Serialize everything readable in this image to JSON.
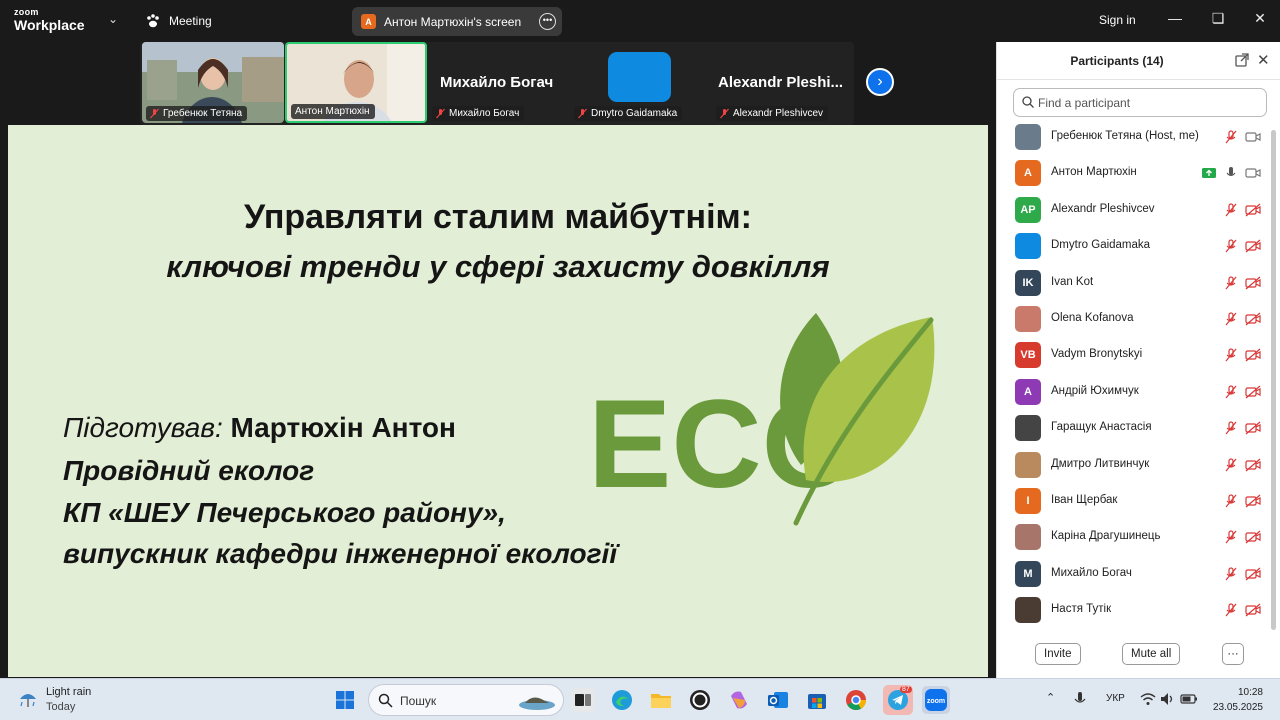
{
  "window": {
    "brand_line1": "zoom",
    "brand_line2": "Workplace",
    "meeting_label": "Meeting",
    "share_initial": "A",
    "share_title": "Антон Мартюхін's screen",
    "signin_label": "Sign in"
  },
  "gallery": {
    "tiles": [
      {
        "name": "Гребенюк Тетяна"
      },
      {
        "name": "Антон Мартюхін"
      },
      {
        "name": "Михайло Богач",
        "display": "Михайло Богач"
      },
      {
        "name": "Dmytro Gaidamaka"
      },
      {
        "name": "Alexandr Pleshivcev",
        "display": "Alexandr  Pleshi..."
      }
    ]
  },
  "slide": {
    "title_line1": "Управляти сталим майбутнім:",
    "title_line2": "ключові тренди у сфері захисту довкілля",
    "prepared_label": "Підготував:",
    "author": "Мартюхін Антон",
    "position": "Провідний еколог",
    "org": "КП «ШЕУ Печерського району»,",
    "alumni": "випускник кафедри інженерної екології",
    "logo_text": "ECO"
  },
  "participants": {
    "title": "Participants (14)",
    "search_placeholder": "Find a participant",
    "list": [
      {
        "name": "Гребенюк Тетяна (Host, me)",
        "initials": "",
        "color": "#6a7b8c",
        "state": "host"
      },
      {
        "name": "Антон Мартюхін",
        "initials": "A",
        "color": "#e5691e",
        "state": "sharing"
      },
      {
        "name": "Alexandr Pleshivcev",
        "initials": "AP",
        "color": "#2eaa4b",
        "state": "muted"
      },
      {
        "name": "Dmytro Gaidamaka",
        "initials": "",
        "color": "#0e8ae0",
        "state": "muted"
      },
      {
        "name": "Ivan Kot",
        "initials": "IK",
        "color": "#34475a",
        "state": "muted"
      },
      {
        "name": "Olena Kofanova",
        "initials": "",
        "color": "#c97a6b",
        "state": "muted"
      },
      {
        "name": "Vadym Bronytskyi",
        "initials": "VB",
        "color": "#d63b2d",
        "state": "muted"
      },
      {
        "name": "Андрій Юхимчук",
        "initials": "A",
        "color": "#8e3ab5",
        "state": "muted"
      },
      {
        "name": "Гаращук Анастасія",
        "initials": "",
        "color": "#444444",
        "state": "muted"
      },
      {
        "name": "Дмитро Литвинчук",
        "initials": "",
        "color": "#b98a5e",
        "state": "muted"
      },
      {
        "name": "Іван Щербак",
        "initials": "I",
        "color": "#e5691e",
        "state": "muted"
      },
      {
        "name": "Каріна Драгушинець",
        "initials": "",
        "color": "#a8756a",
        "state": "muted"
      },
      {
        "name": "Михайло Богач",
        "initials": "M",
        "color": "#34475a",
        "state": "muted"
      },
      {
        "name": "Настя Тутік",
        "initials": "",
        "color": "#4a3b33",
        "state": "muted"
      }
    ],
    "invite_label": "Invite",
    "mute_all_label": "Mute all",
    "more_label": "···"
  },
  "taskbar": {
    "weather_title": "Light rain",
    "weather_sub": "Today",
    "search_placeholder": "Пошук",
    "telegram_badge": "87",
    "language": "УКР",
    "time": "10:28",
    "date": "23.05.2025"
  },
  "colors": {
    "zoom_blue": "#0e72ed",
    "slide_bg": "#e2eed5",
    "leaf_dark": "#6b9a3c",
    "leaf_light": "#a9c24a",
    "muted_red": "#d93636",
    "active_border": "#2ecc71"
  }
}
